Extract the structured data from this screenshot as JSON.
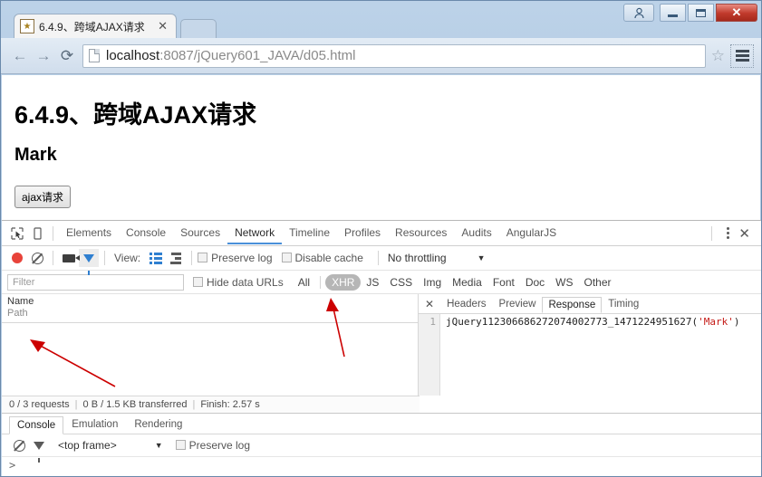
{
  "window": {
    "controls": {
      "user_label": "user-icon",
      "minimize_label": "minimize-icon",
      "maximize_label": "maximize-icon",
      "close_label": "✕"
    }
  },
  "browser": {
    "tab": {
      "title": "6.4.9、跨域AJAX请求",
      "close_label": "✕",
      "favicon": "page-favicon"
    },
    "nav": {
      "back": "←",
      "forward": "→",
      "reload": "⟳"
    },
    "omnibox": {
      "host": "localhost",
      "rest": ":8087/jQuery601_JAVA/d05.html",
      "star": "☆"
    }
  },
  "page": {
    "heading": "6.4.9、跨域AJAX请求",
    "subheading": "Mark",
    "button_label": "ajax请求"
  },
  "devtools": {
    "tabs": [
      {
        "label": "Elements",
        "selected": false
      },
      {
        "label": "Console",
        "selected": false
      },
      {
        "label": "Sources",
        "selected": false
      },
      {
        "label": "Network",
        "selected": true
      },
      {
        "label": "Timeline",
        "selected": false
      },
      {
        "label": "Profiles",
        "selected": false
      },
      {
        "label": "Resources",
        "selected": false
      },
      {
        "label": "Audits",
        "selected": false
      },
      {
        "label": "AngularJS",
        "selected": false
      }
    ],
    "close_label": "✕",
    "network_toolbar": {
      "view_label": "View:",
      "preserve_log": "Preserve log",
      "disable_cache": "Disable cache",
      "throttling": "No throttling",
      "throttling_caret": "▼"
    },
    "filter_bar": {
      "filter_placeholder": "Filter",
      "hide_data_urls": "Hide data URLs",
      "types": [
        {
          "label": "All",
          "selected": false
        },
        {
          "label": "XHR",
          "selected": true
        },
        {
          "label": "JS",
          "selected": false
        },
        {
          "label": "CSS",
          "selected": false
        },
        {
          "label": "Img",
          "selected": false
        },
        {
          "label": "Media",
          "selected": false
        },
        {
          "label": "Font",
          "selected": false
        },
        {
          "label": "Doc",
          "selected": false
        },
        {
          "label": "WS",
          "selected": false
        },
        {
          "label": "Other",
          "selected": false
        }
      ]
    },
    "request_table": {
      "column_name": "Name",
      "column_path": "Path",
      "rows": []
    },
    "status_bar": {
      "requests": "0 / 3 requests",
      "transferred": "0 B / 1.5 KB transferred",
      "finish": "Finish: 2.57 s",
      "separator": "|"
    },
    "detail": {
      "close_label": "✕",
      "tabs": [
        {
          "label": "Headers",
          "selected": false
        },
        {
          "label": "Preview",
          "selected": false
        },
        {
          "label": "Response",
          "selected": true
        },
        {
          "label": "Timing",
          "selected": false
        }
      ],
      "response": {
        "line_number": "1",
        "callback": "jQuery112306686272074002773_1471224951627(",
        "argument": "'Mark'",
        "close_paren": ")"
      }
    },
    "drawer": {
      "tabs": [
        {
          "label": "Console",
          "selected": true
        },
        {
          "label": "Emulation",
          "selected": false
        },
        {
          "label": "Rendering",
          "selected": false
        }
      ],
      "context": "<top frame>",
      "context_caret": "▼",
      "preserve_log": "Preserve log",
      "prompt": ">"
    }
  },
  "annotations": {
    "accent_color": "#cc0000",
    "arrow_1_target": "request-table-empty-area",
    "arrow_2_target": "xhr-filter-button"
  }
}
